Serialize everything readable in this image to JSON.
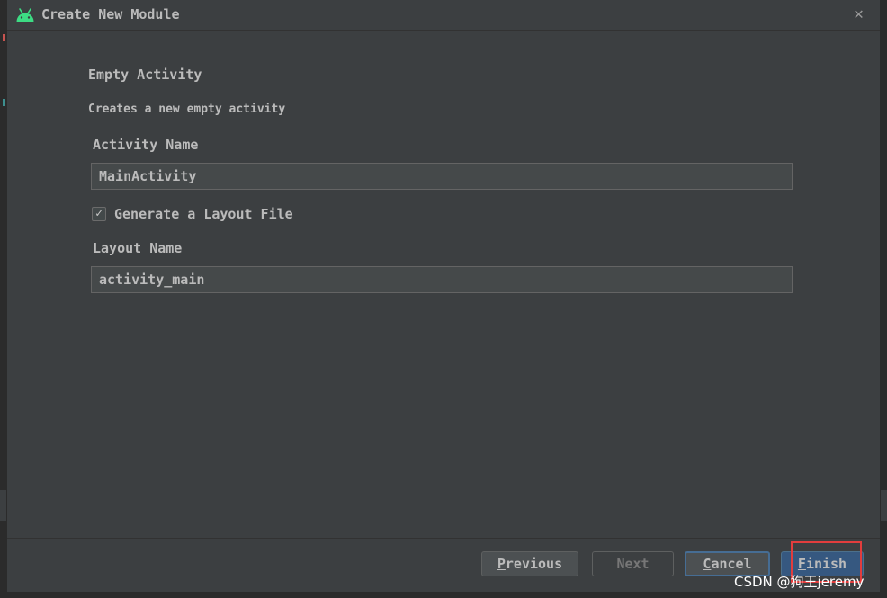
{
  "dialog": {
    "title": "Create New Module",
    "icons": {
      "app_icon": "android-icon",
      "close_icon": "close-icon"
    },
    "close_glyph": "✕"
  },
  "template": {
    "heading": "Empty Activity",
    "description": "Creates a new empty activity"
  },
  "form": {
    "activity_name_label": "Activity Name",
    "activity_name_value": "MainActivity",
    "generate_layout_label": "Generate a Layout File",
    "generate_layout_checked": true,
    "check_glyph": "✓",
    "layout_name_label": "Layout Name",
    "layout_name_value": "activity_main"
  },
  "buttons": {
    "previous": {
      "mnemonic": "P",
      "rest": "revious"
    },
    "next": "Next",
    "cancel": {
      "mnemonic": "C",
      "rest": "ancel"
    },
    "finish": {
      "mnemonic": "F",
      "rest": "inish"
    }
  },
  "watermark": "CSDN @狗王jeremy",
  "colors": {
    "dialog_bg": "#3c3f41",
    "input_bg": "#45494a",
    "primary_button": "#365880",
    "focus_border": "#466d94",
    "highlight_red": "#e23d3d",
    "android_green": "#3ddc84"
  }
}
